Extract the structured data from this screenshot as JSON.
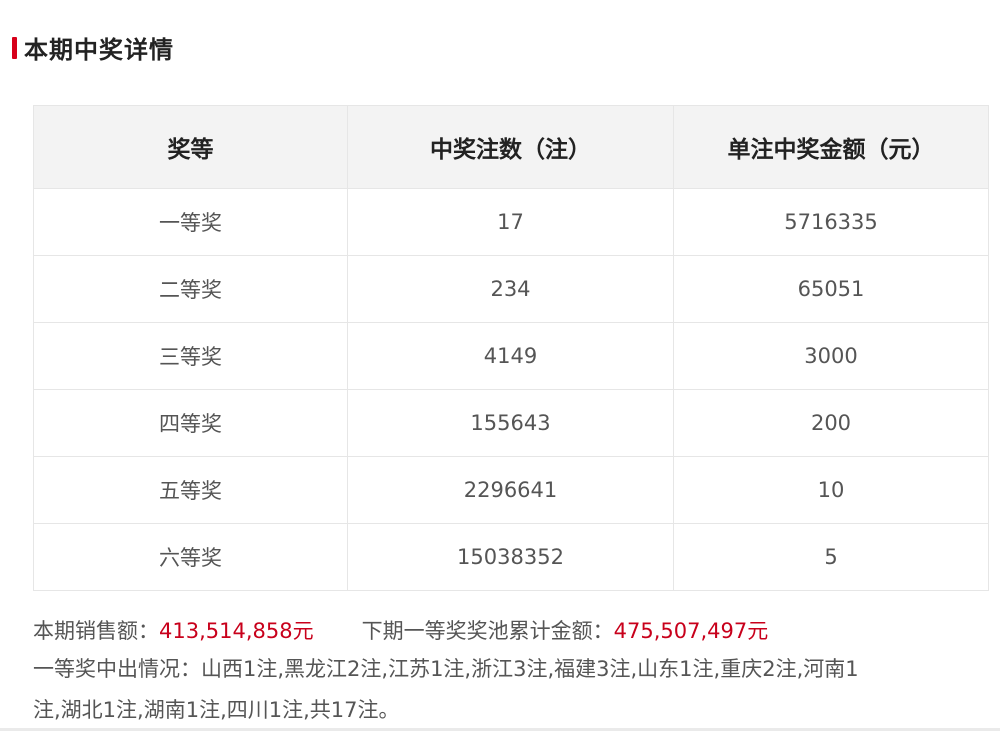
{
  "section_title": "本期中奖详情",
  "table": {
    "headers": [
      "奖等",
      "中奖注数（注）",
      "单注中奖金额（元）"
    ],
    "rows": [
      [
        "一等奖",
        "17",
        "5716335"
      ],
      [
        "二等奖",
        "234",
        "65051"
      ],
      [
        "三等奖",
        "4149",
        "3000"
      ],
      [
        "四等奖",
        "155643",
        "200"
      ],
      [
        "五等奖",
        "2296641",
        "10"
      ],
      [
        "六等奖",
        "15038352",
        "5"
      ]
    ]
  },
  "sales": {
    "label": "本期销售额：",
    "value": "413,514,858元",
    "pool_label": "下期一等奖奖池累计金额：",
    "pool_value": "475,507,497元"
  },
  "distribution": {
    "line1": "一等奖中出情况：山西1注,黑龙江2注,江苏1注,浙江3注,福建3注,山东1注,重庆2注,河南1",
    "line2": "注,湖北1注,湖南1注,四川1注,共17注。"
  },
  "colors": {
    "accent": "#d7001a",
    "highlight": "#c8001b",
    "header_bg": "#f3f3f3"
  }
}
